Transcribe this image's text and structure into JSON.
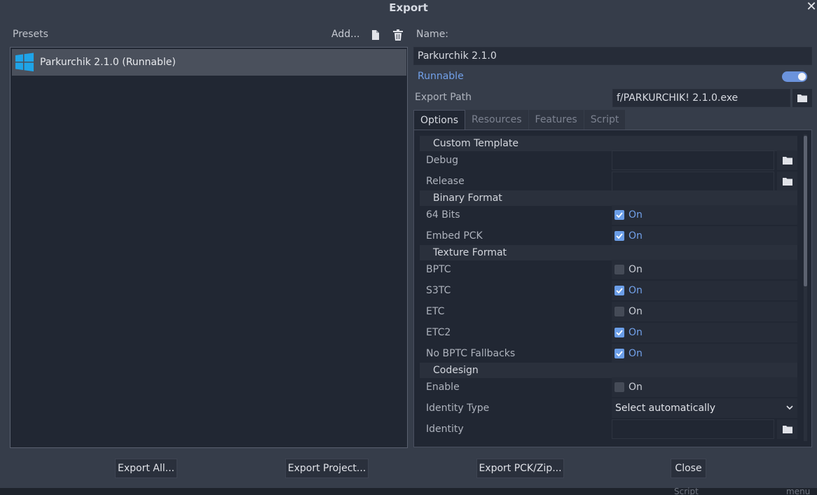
{
  "window": {
    "title": "Export"
  },
  "presets": {
    "label": "Presets",
    "add_label": "Add...",
    "items": [
      {
        "label": "Parkurchik 2.1.0 (Runnable)",
        "platform_icon": "windows-logo-icon"
      }
    ]
  },
  "details": {
    "name_label": "Name:",
    "name_value": "Parkurchik 2.1.0",
    "runnable_label": "Runnable",
    "runnable_enabled": true,
    "export_path_label": "Export Path",
    "export_path_value": "f/PARKURCHIK! 2.1.0.exe"
  },
  "tabs": [
    "Options",
    "Resources",
    "Features",
    "Script"
  ],
  "options": {
    "custom_template": {
      "heading": "Custom Template",
      "debug_label": "Debug",
      "debug_value": "",
      "release_label": "Release",
      "release_value": ""
    },
    "binary_format": {
      "heading": "Binary Format",
      "bits64_label": "64 Bits",
      "bits64_state": "On",
      "bits64_checked": true,
      "embed_pck_label": "Embed PCK",
      "embed_pck_state": "On",
      "embed_pck_checked": true
    },
    "texture_format": {
      "heading": "Texture Format",
      "bptc_label": "BPTC",
      "bptc_state": "On",
      "bptc_checked": false,
      "s3tc_label": "S3TC",
      "s3tc_state": "On",
      "s3tc_checked": true,
      "etc_label": "ETC",
      "etc_state": "On",
      "etc_checked": false,
      "etc2_label": "ETC2",
      "etc2_state": "On",
      "etc2_checked": true,
      "no_bptc_label": "No BPTC Fallbacks",
      "no_bptc_state": "On",
      "no_bptc_checked": true
    },
    "codesign": {
      "heading": "Codesign",
      "enable_label": "Enable",
      "enable_state": "On",
      "enable_checked": false,
      "identity_type_label": "Identity Type",
      "identity_type_value": "Select automatically",
      "identity_label": "Identity",
      "identity_value": ""
    }
  },
  "footer": {
    "export_all": "Export All...",
    "export_project": "Export Project...",
    "export_pck": "Export PCK/Zip...",
    "close": "Close"
  },
  "background_strip": {
    "left_text": "Script",
    "right_text": "menu"
  },
  "colors": {
    "accent": "#6b9ee8",
    "background": "#363d4a",
    "panel": "#212733"
  }
}
